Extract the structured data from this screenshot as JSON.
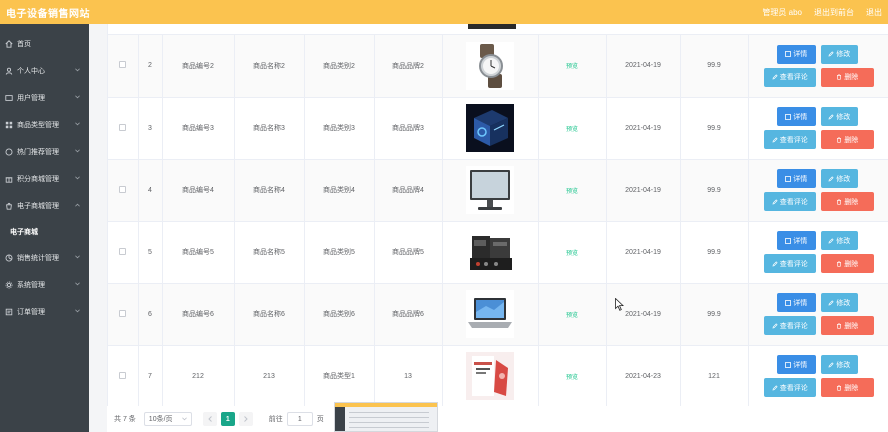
{
  "app": {
    "title": "电子设备销售网站"
  },
  "top_links": [
    "管理员 abo",
    "退出到前台",
    "退出"
  ],
  "sidebar": {
    "items": [
      {
        "label": "首页",
        "icon": "home-icon",
        "expandable": false
      },
      {
        "label": "个人中心",
        "icon": "user-icon",
        "expandable": true
      },
      {
        "label": "用户管理",
        "icon": "users-icon",
        "expandable": true
      },
      {
        "label": "商品类型管理",
        "icon": "grid-icon",
        "expandable": true
      },
      {
        "label": "热门推荐管理",
        "icon": "chat-icon",
        "expandable": true
      },
      {
        "label": "积分商城管理",
        "icon": "gift-icon",
        "expandable": true
      },
      {
        "label": "电子商城管理",
        "icon": "bag-icon",
        "expandable": true,
        "open": true
      },
      {
        "label": "电子商城",
        "submenu": true
      },
      {
        "label": "销售统计管理",
        "icon": "chart-icon",
        "expandable": true
      },
      {
        "label": "系统管理",
        "icon": "settings-icon",
        "expandable": true
      },
      {
        "label": "订单管理",
        "icon": "order-icon",
        "expandable": true
      }
    ]
  },
  "colors": {
    "topbar": "#fbc34f",
    "sidebar": "#3b4248",
    "primary": "#3a8ee6",
    "info": "#56b6e0",
    "danger": "#f56c59",
    "success": "#19c48b",
    "page_active": "#19a689"
  },
  "buttons": {
    "detail": "详情",
    "edit": "修改",
    "review": "查看评论",
    "delete": "删除"
  },
  "rows": [
    {
      "index": "2",
      "code": "商品编号2",
      "name": "商品名称2",
      "type": "商品类别2",
      "brand": "商品品牌2",
      "image": "watch",
      "status": "预览",
      "date": "2021-04-19",
      "price": "99.9"
    },
    {
      "index": "3",
      "code": "商品编号3",
      "name": "商品名称3",
      "type": "商品类别3",
      "brand": "商品品牌3",
      "image": "pc-case",
      "status": "预览",
      "date": "2021-04-19",
      "price": "99.9"
    },
    {
      "index": "4",
      "code": "商品编号4",
      "name": "商品名称4",
      "type": "商品类别4",
      "brand": "商品品牌4",
      "image": "monitor",
      "status": "预览",
      "date": "2021-04-19",
      "price": "99.9"
    },
    {
      "index": "5",
      "code": "商品编号5",
      "name": "商品名称5",
      "type": "商品类别5",
      "brand": "商品品牌5",
      "image": "audio-mixer",
      "status": "预览",
      "date": "2021-04-19",
      "price": "99.9"
    },
    {
      "index": "6",
      "code": "商品编号6",
      "name": "商品名称6",
      "type": "商品类别6",
      "brand": "商品品牌6",
      "image": "laptop",
      "status": "预览",
      "date": "2021-04-19",
      "price": "99.9"
    },
    {
      "index": "7",
      "code": "212",
      "name": "213",
      "type": "商品类型1",
      "brand": "13",
      "image": "gift-card",
      "status": "预览",
      "date": "2021-04-23",
      "price": "121"
    }
  ],
  "pagination": {
    "total": "共 7 条",
    "page_size": "10条/页",
    "current": "1",
    "goto_label": "前往",
    "goto_value": "1",
    "page_suffix": "页"
  }
}
